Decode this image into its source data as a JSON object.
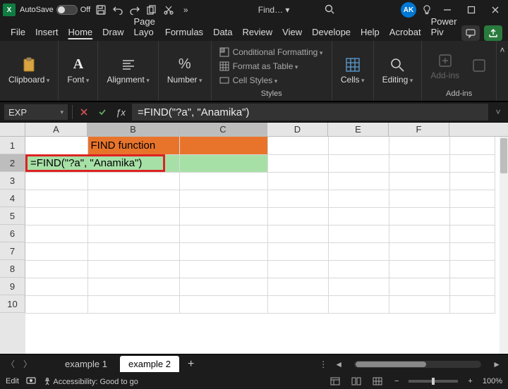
{
  "titlebar": {
    "app_initial": "X",
    "autosave_label": "AutoSave",
    "autosave_state": "Off",
    "doc_name": "Find…",
    "user_initials": "AK"
  },
  "tabs": {
    "items": [
      "File",
      "Insert",
      "Home",
      "Draw",
      "Page Layo",
      "Formulas",
      "Data",
      "Review",
      "View",
      "Develope",
      "Help",
      "Acrobat",
      "Power Piv"
    ],
    "active_index": 2
  },
  "ribbon": {
    "clipboard": "Clipboard",
    "font": "Font",
    "alignment": "Alignment",
    "number": "Number",
    "styles": "Styles",
    "cond_fmt": "Conditional Formatting",
    "fmt_table": "Format as Table",
    "cell_styles": "Cell Styles",
    "cells": "Cells",
    "editing": "Editing",
    "addins": "Add-ins",
    "addins_group": "Add-ins"
  },
  "formula_bar": {
    "name_box": "EXP",
    "formula": "=FIND(\"?a\", \"Anamika\")"
  },
  "grid": {
    "columns": [
      "A",
      "B",
      "C",
      "D",
      "E",
      "F"
    ],
    "rows": [
      "1",
      "2",
      "3",
      "4",
      "5",
      "6",
      "7",
      "8",
      "9",
      "10"
    ],
    "b1": "FIND function",
    "b2_display": "=FIND(\"?a\", \"Anamika\")",
    "active_cell": "B2"
  },
  "sheet_bar": {
    "tabs": [
      "example 1",
      "example 2"
    ],
    "active_index": 1
  },
  "status": {
    "mode": "Edit",
    "accessibility": "Accessibility: Good to go",
    "zoom": "100%"
  }
}
